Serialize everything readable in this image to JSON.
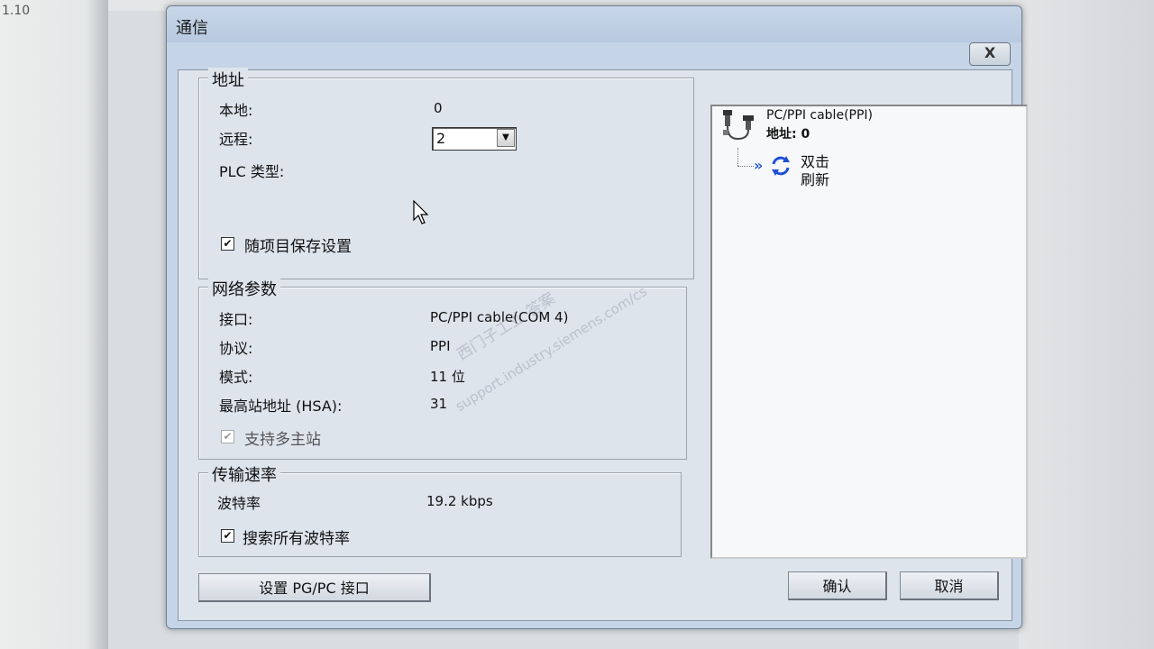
{
  "background": {
    "version_text": "1.10"
  },
  "dialog": {
    "title": "通信",
    "close_label": "X",
    "address": {
      "group_label": "地址",
      "local_label": "本地:",
      "local_value": "0",
      "remote_label": "远程:",
      "remote_value": "2",
      "plc_type_label": "PLC 类型:",
      "save_settings_label": "随项目保存设置",
      "save_settings_checked": true
    },
    "network": {
      "group_label": "网络参数",
      "interface_label": "接口:",
      "interface_value": "PC/PPI cable(COM 4)",
      "protocol_label": "协议:",
      "protocol_value": "PPI",
      "mode_label": "模式:",
      "mode_value": "11 位",
      "hsa_label": "最高站地址 (HSA):",
      "hsa_value": "31",
      "multi_master_label": "支持多主站",
      "multi_master_checked": true
    },
    "transmission": {
      "group_label": "传输速率",
      "baud_label": "波特率",
      "baud_value": "19.2 kbps",
      "search_all_label": "搜索所有波特率",
      "search_all_checked": true
    },
    "tree": {
      "cable_label": "PC/PPI cable(PPI)",
      "address_label": "地址: 0",
      "refresh_line1": "双击",
      "refresh_line2": "刷新"
    },
    "buttons": {
      "setup_pgpc": "设置 PG/PC 接口",
      "ok": "确认",
      "cancel": "取消"
    },
    "watermark": {
      "line1": "西门子工业 答案",
      "line2": "support.industry.siemens.com/cs"
    }
  }
}
